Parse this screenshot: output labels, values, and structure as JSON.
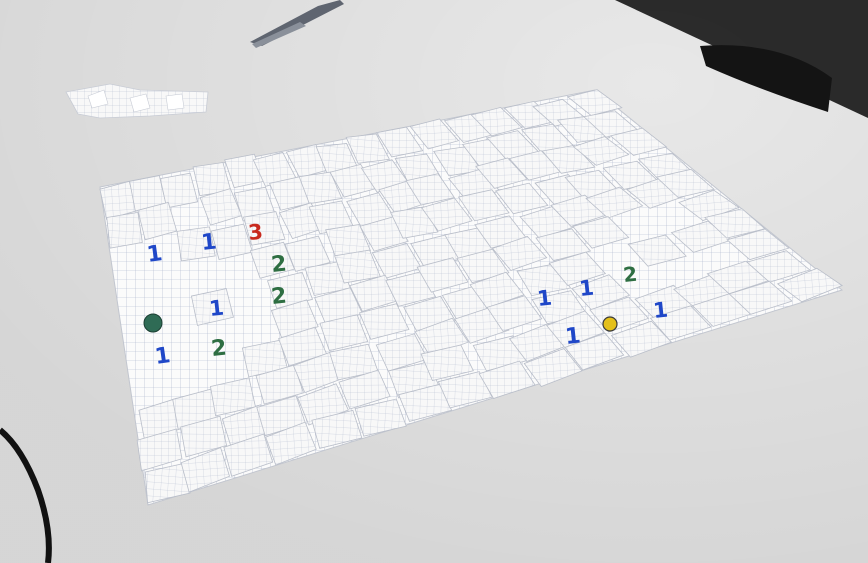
{
  "scene": {
    "colors": {
      "table": "#e9e9e9",
      "paper": "#fbfbfb",
      "grid_line": "#9aa6c0",
      "tile": "#f7f7f7",
      "tile_edge": "#b9bec9",
      "blue_digit": "#1f47c8",
      "green_digit": "#2e6e42",
      "red_digit": "#c8291d",
      "flag_green": "#2f6b55",
      "flag_yellow": "#e4c01a"
    },
    "objects": [
      "grid-paper-board",
      "paper-tile",
      "scissors",
      "cable",
      "chair",
      "paper-scraps"
    ]
  },
  "board": {
    "cells": [
      {
        "text": "1",
        "color": "blue"
      },
      {
        "text": "1",
        "color": "blue"
      },
      {
        "text": "3",
        "color": "red"
      },
      {
        "text": "2",
        "color": "green"
      },
      {
        "text": "2",
        "color": "green"
      },
      {
        "text": "1",
        "color": "blue"
      },
      {
        "text": "1",
        "color": "blue"
      },
      {
        "text": "2",
        "color": "green"
      },
      {
        "text": "1",
        "color": "blue"
      },
      {
        "text": "1",
        "color": "blue"
      },
      {
        "text": "2",
        "color": "green"
      },
      {
        "text": "1",
        "color": "blue"
      },
      {
        "text": "1",
        "color": "blue"
      }
    ],
    "markers": [
      {
        "kind": "green-dot"
      },
      {
        "kind": "yellow-dot"
      }
    ]
  }
}
